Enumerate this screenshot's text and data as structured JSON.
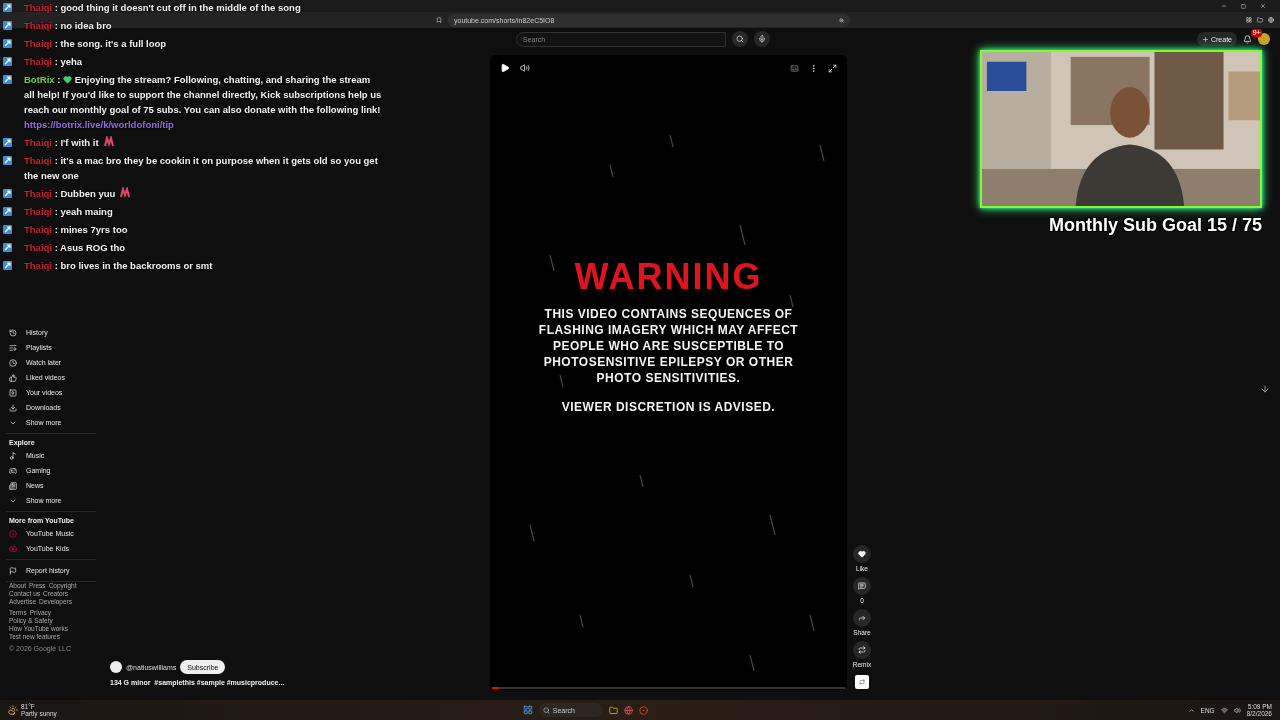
{
  "browser": {
    "url": "youtube.com/shorts/in82eC5IO8"
  },
  "header": {
    "search": {
      "placeholder": "Search"
    },
    "create": "Create",
    "notifications": "9+"
  },
  "sidebar": {
    "sections": [
      {
        "items": [
          "History",
          "Playlists",
          "Watch later",
          "Liked videos",
          "Your videos",
          "Downloads",
          "Show more"
        ]
      },
      {
        "title": "Explore",
        "items": [
          "Music",
          "Gaming",
          "News",
          "Show more"
        ]
      },
      {
        "title": "More from YouTube",
        "items": [
          "YouTube Music",
          "YouTube Kids"
        ]
      },
      {
        "items": [
          "Report history"
        ]
      }
    ],
    "footer": [
      [
        "About",
        "Press",
        "Copyright"
      ],
      [
        "Contact us",
        "Creators"
      ],
      [
        "Advertise",
        "Developers"
      ],
      [
        "Terms",
        "Privacy"
      ],
      [
        "Policy & Safety"
      ],
      [
        "How YouTube works"
      ],
      [
        "Test new features"
      ]
    ],
    "copyright": "© 2026 Google LLC"
  },
  "video": {
    "warning": "WARNING",
    "body": "THIS VIDEO CONTAINS SEQUENCES OF FLASHING IMAGERY WHICH MAY AFFECT PEOPLE WHO ARE SUSCEPTIBLE TO PHOTOSENSITIVE EPILEPSY OR OTHER PHOTO SENSITIVITIES.",
    "advice": "VIEWER DISCRETION IS ADVISED.",
    "progress": {
      "level": 0.02
    }
  },
  "actions": [
    {
      "label": "Like"
    },
    {
      "label": "0"
    },
    {
      "label": "Share"
    },
    {
      "label": "Remix"
    }
  ],
  "channel": {
    "handle": "@natiuswilliams",
    "subscribe": "Subscribe",
    "title": "134 G minor  #samplethis #sample #musicproduce..."
  },
  "chat": [
    {
      "kind": "user",
      "user": "Thaiqi",
      "sep": ":",
      "color": "#c4203a",
      "text": "good thing it doesn't cut off in the middle of the song",
      "emote": false
    },
    {
      "kind": "user",
      "user": "Thaiqi",
      "sep": ":",
      "color": "#c4203a",
      "text": "no idea bro",
      "emote": false
    },
    {
      "kind": "user",
      "user": "Thaiqi",
      "sep": ":",
      "color": "#c4203a",
      "text": "the song. it's a full loop",
      "emote": false
    },
    {
      "kind": "user",
      "user": "Thaiqi",
      "sep": ":",
      "color": "#c4203a",
      "text": "yeha",
      "emote": false
    },
    {
      "kind": "bot",
      "user": "BotRix",
      "sep": ":",
      "color": "#6fd43c",
      "text": "Enjoying the stream? Following, chatting, and sharing the stream all help! If you'd like to support the channel directly, Kick subscriptions help us reach our monthly goal of 75 subs. You can also donate with the following link!",
      "link": "https://botrix.live/k/worldofoni/tip",
      "emote": false
    },
    {
      "kind": "user",
      "user": "Thaiqi",
      "sep": ":",
      "color": "#c4203a",
      "text": "I'f with it",
      "emote": true
    },
    {
      "kind": "user",
      "user": "Thaiqi",
      "sep": ":",
      "color": "#c4203a",
      "text": "it's a mac bro they be cookin it on purpose when it gets old so you get the new one",
      "emote": false
    },
    {
      "kind": "user",
      "user": "Thaiqi",
      "sep": ":",
      "color": "#c4203a",
      "text": "Dubben yuu",
      "emote": true
    },
    {
      "kind": "user",
      "user": "Thaiqi",
      "sep": ":",
      "color": "#c4203a",
      "text": "yeah maing",
      "emote": false
    },
    {
      "kind": "user",
      "user": "Thaiqi",
      "sep": ":",
      "color": "#c4203a",
      "text": "mines 7yrs too",
      "emote": false
    },
    {
      "kind": "user",
      "user": "Thaiqi",
      "sep": ":",
      "color": "#c4203a",
      "text": "Asus ROG tho",
      "emote": false
    },
    {
      "kind": "user",
      "user": "Thaiqi",
      "sep": ":",
      "color": "#c4203a",
      "text": "bro lives in the backrooms or smt",
      "emote": false
    }
  ],
  "overlay": {
    "goal": "Monthly Sub Goal 15 / 75"
  },
  "taskbar": {
    "temperature": "81°F",
    "weather": "Partly sunny",
    "search": "Search",
    "language": "ENG",
    "time": "5:09 PM",
    "date": "8/2/2026"
  }
}
